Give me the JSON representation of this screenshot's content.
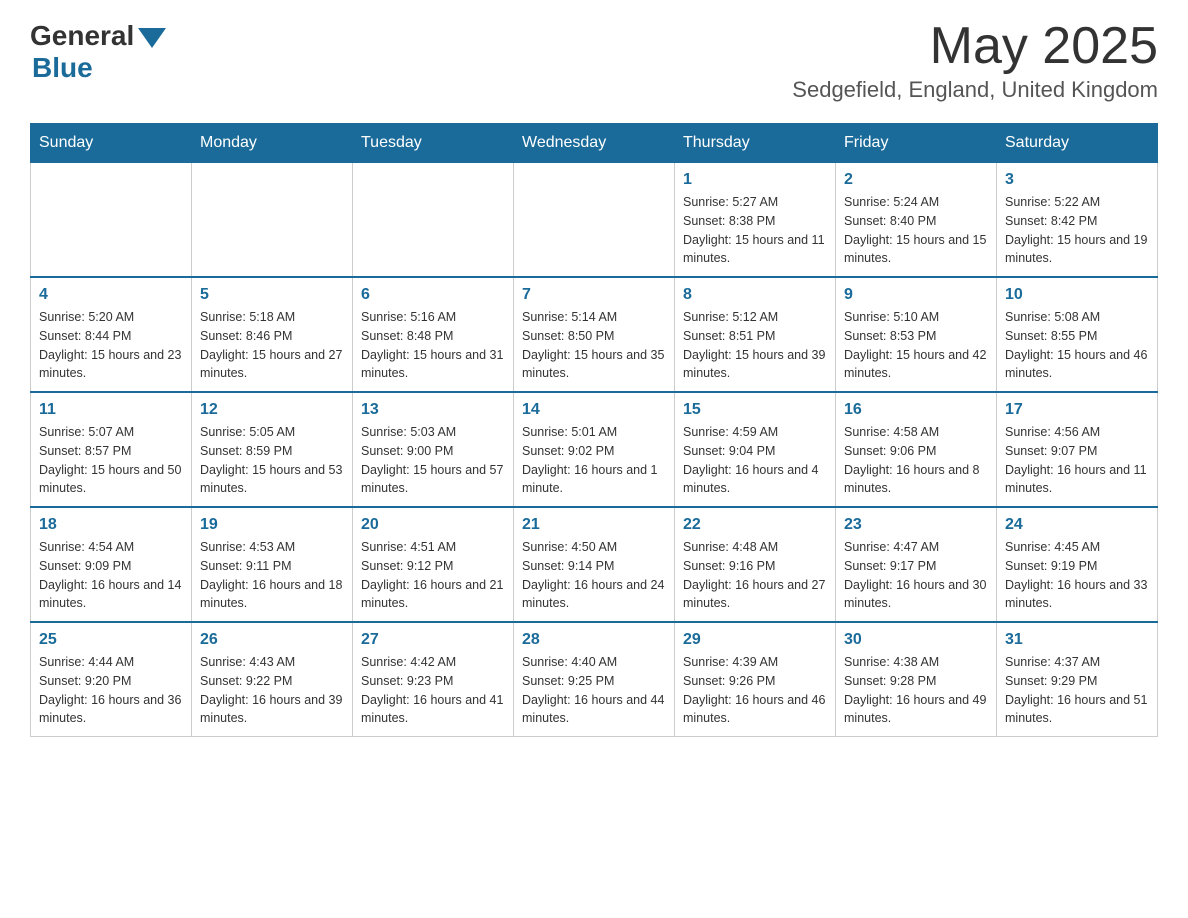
{
  "header": {
    "logo_general": "General",
    "logo_blue": "Blue",
    "month_title": "May 2025",
    "location": "Sedgefield, England, United Kingdom"
  },
  "calendar": {
    "days_of_week": [
      "Sunday",
      "Monday",
      "Tuesday",
      "Wednesday",
      "Thursday",
      "Friday",
      "Saturday"
    ],
    "weeks": [
      [
        {
          "day": "",
          "info": ""
        },
        {
          "day": "",
          "info": ""
        },
        {
          "day": "",
          "info": ""
        },
        {
          "day": "",
          "info": ""
        },
        {
          "day": "1",
          "info": "Sunrise: 5:27 AM\nSunset: 8:38 PM\nDaylight: 15 hours and 11 minutes."
        },
        {
          "day": "2",
          "info": "Sunrise: 5:24 AM\nSunset: 8:40 PM\nDaylight: 15 hours and 15 minutes."
        },
        {
          "day": "3",
          "info": "Sunrise: 5:22 AM\nSunset: 8:42 PM\nDaylight: 15 hours and 19 minutes."
        }
      ],
      [
        {
          "day": "4",
          "info": "Sunrise: 5:20 AM\nSunset: 8:44 PM\nDaylight: 15 hours and 23 minutes."
        },
        {
          "day": "5",
          "info": "Sunrise: 5:18 AM\nSunset: 8:46 PM\nDaylight: 15 hours and 27 minutes."
        },
        {
          "day": "6",
          "info": "Sunrise: 5:16 AM\nSunset: 8:48 PM\nDaylight: 15 hours and 31 minutes."
        },
        {
          "day": "7",
          "info": "Sunrise: 5:14 AM\nSunset: 8:50 PM\nDaylight: 15 hours and 35 minutes."
        },
        {
          "day": "8",
          "info": "Sunrise: 5:12 AM\nSunset: 8:51 PM\nDaylight: 15 hours and 39 minutes."
        },
        {
          "day": "9",
          "info": "Sunrise: 5:10 AM\nSunset: 8:53 PM\nDaylight: 15 hours and 42 minutes."
        },
        {
          "day": "10",
          "info": "Sunrise: 5:08 AM\nSunset: 8:55 PM\nDaylight: 15 hours and 46 minutes."
        }
      ],
      [
        {
          "day": "11",
          "info": "Sunrise: 5:07 AM\nSunset: 8:57 PM\nDaylight: 15 hours and 50 minutes."
        },
        {
          "day": "12",
          "info": "Sunrise: 5:05 AM\nSunset: 8:59 PM\nDaylight: 15 hours and 53 minutes."
        },
        {
          "day": "13",
          "info": "Sunrise: 5:03 AM\nSunset: 9:00 PM\nDaylight: 15 hours and 57 minutes."
        },
        {
          "day": "14",
          "info": "Sunrise: 5:01 AM\nSunset: 9:02 PM\nDaylight: 16 hours and 1 minute."
        },
        {
          "day": "15",
          "info": "Sunrise: 4:59 AM\nSunset: 9:04 PM\nDaylight: 16 hours and 4 minutes."
        },
        {
          "day": "16",
          "info": "Sunrise: 4:58 AM\nSunset: 9:06 PM\nDaylight: 16 hours and 8 minutes."
        },
        {
          "day": "17",
          "info": "Sunrise: 4:56 AM\nSunset: 9:07 PM\nDaylight: 16 hours and 11 minutes."
        }
      ],
      [
        {
          "day": "18",
          "info": "Sunrise: 4:54 AM\nSunset: 9:09 PM\nDaylight: 16 hours and 14 minutes."
        },
        {
          "day": "19",
          "info": "Sunrise: 4:53 AM\nSunset: 9:11 PM\nDaylight: 16 hours and 18 minutes."
        },
        {
          "day": "20",
          "info": "Sunrise: 4:51 AM\nSunset: 9:12 PM\nDaylight: 16 hours and 21 minutes."
        },
        {
          "day": "21",
          "info": "Sunrise: 4:50 AM\nSunset: 9:14 PM\nDaylight: 16 hours and 24 minutes."
        },
        {
          "day": "22",
          "info": "Sunrise: 4:48 AM\nSunset: 9:16 PM\nDaylight: 16 hours and 27 minutes."
        },
        {
          "day": "23",
          "info": "Sunrise: 4:47 AM\nSunset: 9:17 PM\nDaylight: 16 hours and 30 minutes."
        },
        {
          "day": "24",
          "info": "Sunrise: 4:45 AM\nSunset: 9:19 PM\nDaylight: 16 hours and 33 minutes."
        }
      ],
      [
        {
          "day": "25",
          "info": "Sunrise: 4:44 AM\nSunset: 9:20 PM\nDaylight: 16 hours and 36 minutes."
        },
        {
          "day": "26",
          "info": "Sunrise: 4:43 AM\nSunset: 9:22 PM\nDaylight: 16 hours and 39 minutes."
        },
        {
          "day": "27",
          "info": "Sunrise: 4:42 AM\nSunset: 9:23 PM\nDaylight: 16 hours and 41 minutes."
        },
        {
          "day": "28",
          "info": "Sunrise: 4:40 AM\nSunset: 9:25 PM\nDaylight: 16 hours and 44 minutes."
        },
        {
          "day": "29",
          "info": "Sunrise: 4:39 AM\nSunset: 9:26 PM\nDaylight: 16 hours and 46 minutes."
        },
        {
          "day": "30",
          "info": "Sunrise: 4:38 AM\nSunset: 9:28 PM\nDaylight: 16 hours and 49 minutes."
        },
        {
          "day": "31",
          "info": "Sunrise: 4:37 AM\nSunset: 9:29 PM\nDaylight: 16 hours and 51 minutes."
        }
      ]
    ]
  }
}
